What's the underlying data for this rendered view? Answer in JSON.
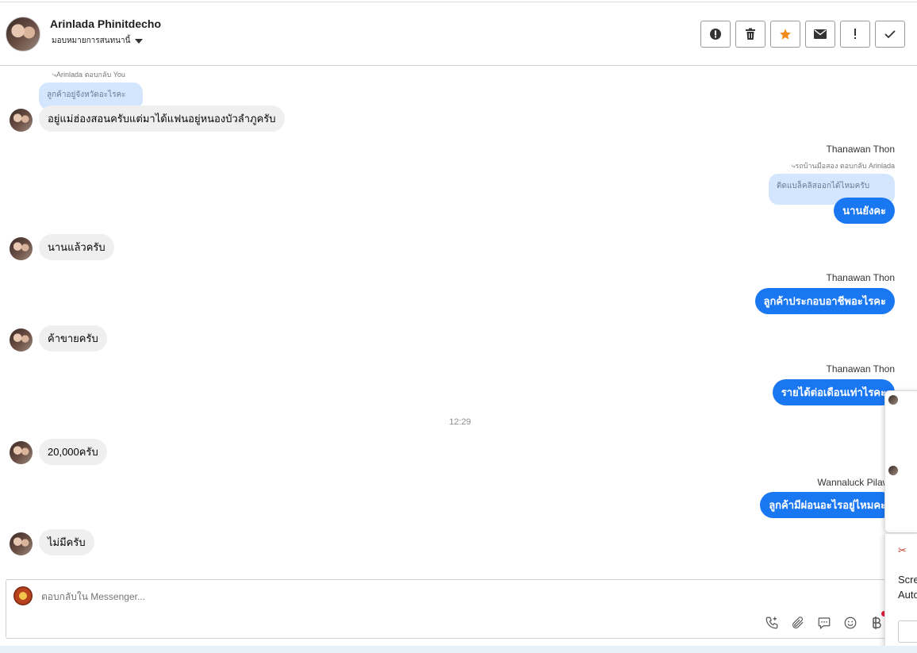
{
  "header": {
    "contact_name": "Arinlada Phinitdecho",
    "assign_label": "มอบหมายการสนทนานี้",
    "actions": [
      {
        "icon": "alert-circle-icon",
        "glyph": "!"
      },
      {
        "icon": "trash-icon",
        "glyph": "🗑"
      },
      {
        "icon": "star-icon",
        "glyph": "★"
      },
      {
        "icon": "envelope-icon",
        "glyph": "✉"
      },
      {
        "icon": "exclamation-icon",
        "glyph": "!"
      },
      {
        "icon": "checkmark-icon",
        "glyph": "✓"
      }
    ]
  },
  "thread": {
    "messages": [
      {
        "reply_meta": "Arinlada ตอบกลับ You",
        "quote": "ลูกค้าอยู่จังหวัดอะไรคะ",
        "text": "อยู่แม่ฮ่องสอนครับแต่มาได้แฟนอยู่หนองบัวลำภูครับ",
        "dir": "in"
      },
      {
        "sender": "Thanawan Thon",
        "reply_meta": "รถบ้านมือสอง ตอบกลับ Arinlada",
        "quote": "ติดแบล็คลิสออกได้ไหมครับ",
        "text": "นานยังคะ",
        "dir": "out"
      },
      {
        "text": "นานแล้วครับ",
        "dir": "in"
      },
      {
        "sender": "Thanawan Thon",
        "text": "ลูกค้าประกอบอาชีพอะไรคะ",
        "dir": "out"
      },
      {
        "text": "ค้าขายครับ",
        "dir": "in"
      },
      {
        "sender": "Thanawan Thon",
        "text": "รายได้ต่อเดือนเท่าไรคะ",
        "dir": "out"
      },
      {
        "text": "20,000ครับ",
        "dir": "in"
      },
      {
        "sender": "Wannaluck Pilawa",
        "text": "ลูกค้ามีผ่อนอะไรอยู่ไหมคะ",
        "dir": "out"
      },
      {
        "text": "ไม่มีครับ",
        "dir": "in"
      }
    ],
    "timestamp": "12:29"
  },
  "composer": {
    "placeholder": "ตอบกลับใน Messenger...",
    "tools": [
      "phone-plus-icon",
      "paperclip-icon",
      "chat-bubble-icon",
      "smiley-icon",
      "baht-icon"
    ]
  },
  "side_popup": {
    "text_line1": "Scre",
    "text_line2": "Auto"
  }
}
